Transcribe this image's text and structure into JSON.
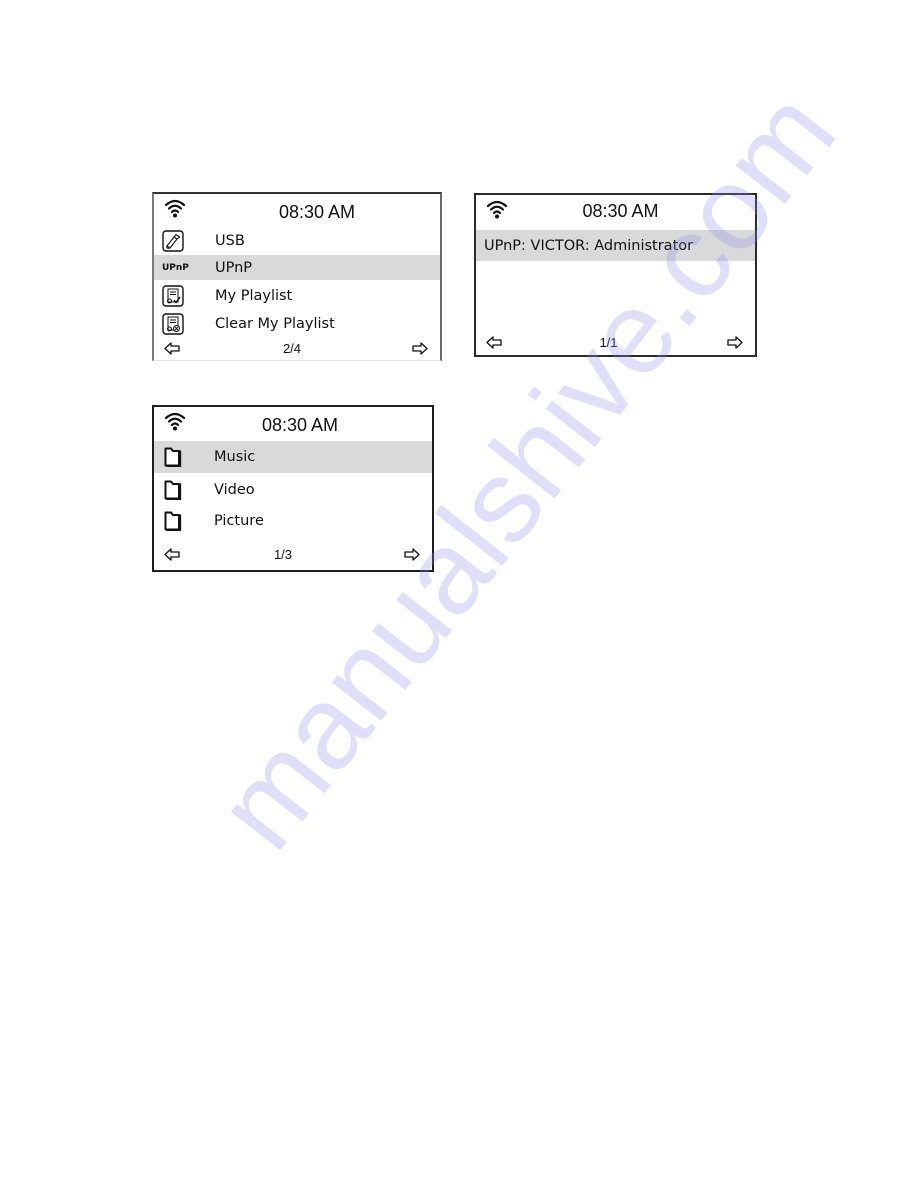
{
  "screens": [
    {
      "id": "source-menu",
      "time": "08:30 AM",
      "items": [
        {
          "icon": "usb-icon",
          "label": "USB",
          "selected": false
        },
        {
          "icon": "upnp-badge",
          "badge_text": "UPnP",
          "label": "UPnP",
          "selected": true
        },
        {
          "icon": "playlist-icon",
          "label": "My Playlist",
          "selected": false
        },
        {
          "icon": "clear-playlist-icon",
          "label": "Clear My Playlist",
          "selected": false
        }
      ],
      "page": "2/4"
    },
    {
      "id": "upnp-server-list",
      "time": "08:30 AM",
      "items": [
        {
          "label": "UPnP: VICTOR: Administrator",
          "selected": true
        }
      ],
      "page": "1/1"
    },
    {
      "id": "media-folders",
      "time": "08:30 AM",
      "items": [
        {
          "icon": "folder-icon",
          "label": "Music",
          "selected": true
        },
        {
          "icon": "folder-icon",
          "label": "Video",
          "selected": false
        },
        {
          "icon": "folder-icon",
          "label": "Picture",
          "selected": false
        }
      ],
      "page": "1/3"
    }
  ],
  "icons": {
    "wifi": "wifi-icon",
    "prev": "arrow-left-icon",
    "next": "arrow-right-icon"
  },
  "colors": {
    "highlight": "#d9d9d9",
    "text": "#111111",
    "watermark": "#8c8ceb"
  },
  "watermark": "manualshive.com"
}
